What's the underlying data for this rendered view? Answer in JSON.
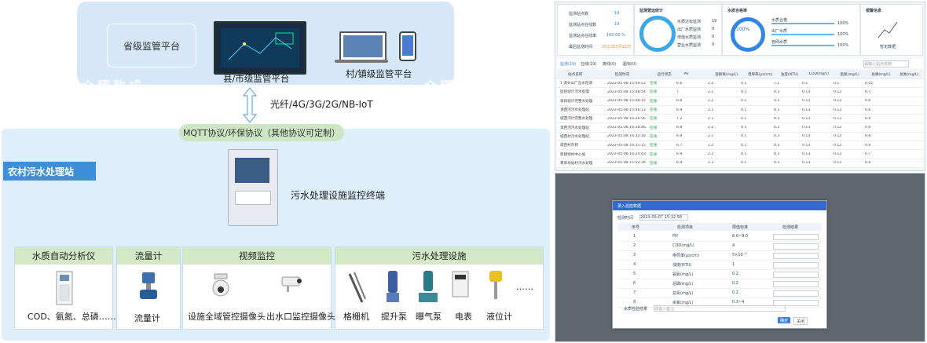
{
  "diagram": {
    "provincial_platform": "省级监管平台",
    "county_platform": "县/市级监管平台",
    "village_platform": "村/镇级监管平台",
    "network": "光纤/4G/3G/2G/NB-IoT",
    "protocol": "MQTT协议/环保协议（其他协议可定制）",
    "station": "农村污水处理站",
    "terminal": "污水处理设施监控终端",
    "watermark": "众耀数成",
    "groups": [
      {
        "title": "水质自动分析仪",
        "items": [
          "COD、氨氮、总磷……"
        ]
      },
      {
        "title": "流量计",
        "items": [
          "流量计"
        ]
      },
      {
        "title": "视频监控",
        "items": [
          "设施全域管控摄像头",
          "出水口监控摄像头"
        ]
      },
      {
        "title": "污水处理设施",
        "items": [
          "格栅机",
          "提升泵",
          "曝气泵",
          "电表",
          "液位计"
        ],
        "more": "……"
      }
    ]
  },
  "dashboard": {
    "stats": [
      {
        "label": "监测站点数",
        "value": "19"
      },
      {
        "label": "监测站点在线数",
        "value": "19"
      },
      {
        "label": "监测站点在线率",
        "value": "100.00 %"
      },
      {
        "label": "最后监测时间",
        "value": "2023年5月22日"
      }
    ],
    "sections": [
      "监测营运统计",
      "水质合格率",
      "报警信息"
    ],
    "gauge_value": "100",
    "gauge_unit": "%",
    "gauge_label": "水质合格率",
    "alarm_label": "暂无数据",
    "legend": [
      {
        "label": "水质达标监测",
        "value": "19"
      },
      {
        "label": "出厂水质监测",
        "value": "0"
      },
      {
        "label": "增值水质监测",
        "value": "0"
      },
      {
        "label": "营业水质监测",
        "value": "0"
      }
    ],
    "quality_bars": [
      {
        "label": "水质合格",
        "value": "100%"
      },
      {
        "label": "出厂水质",
        "value": "100%"
      },
      {
        "label": "管网水质",
        "value": "100%"
      }
    ],
    "tabs": [
      "监测(19)",
      "在线(19)",
      "离线(0)",
      "超标(0)"
    ],
    "search_placeholder": "请输入站点名称",
    "table_headers": [
      "站点名称",
      "检测时间",
      "运行状态",
      "PH",
      "溶解氧(mg/L)",
      "电导率(μs/cm)",
      "浊度(NTU)",
      "COD(mg/L)",
      "氨氮(mg/L)",
      "总磷(mg/L)",
      "总氮(mg/L)"
    ],
    "table_rows": [
      [
        "1 源头山厂出水检测",
        "2023-05-08 15:49:53",
        "在线",
        "6.6",
        "2.2",
        "0.1",
        "7.1",
        "0.1",
        "0.1",
        "0.05"
      ],
      [
        "监控站计污水处理",
        "2023-05-08 15:48:54",
        "在线",
        "7",
        "2.1",
        "0.1",
        "0.3",
        "0.13",
        "0.12",
        "0.7"
      ],
      [
        "第四组计完整水处理",
        "2023-05-08 15:48:15",
        "在线",
        "6.8",
        "2.2",
        "0.1",
        "0.3",
        "0.13",
        "0.12",
        "0.6"
      ],
      [
        "涌西河污水处理站",
        "2023-05-08 15:46:13",
        "在线",
        "6.9",
        "2.1",
        "0.1",
        "0.3",
        "0.13",
        "0.12",
        "0.6"
      ],
      [
        "城西河计完整水处理",
        "2023-05-08 16:26:56",
        "在线",
        "7.2",
        "2.1",
        "0.1",
        "0.3",
        "0.13",
        "0.12",
        "0.6"
      ],
      [
        "涌西河污水处理站",
        "2023-05-08 16:28:46",
        "在线",
        "6.8",
        "2.2",
        "0.1",
        "0.3",
        "0.13",
        "0.12",
        "0.6"
      ],
      [
        "城西村污水处理站",
        "2023-05-08 16:32:18",
        "在线",
        "6.8",
        "2.1",
        "0.1",
        "0.3",
        "0.13",
        "0.12",
        "0.6"
      ],
      [
        "城西村东侧",
        "2023-05-08 16:31:15",
        "在线",
        "6.7",
        "2.2",
        "0.1",
        "0.3",
        "0.13",
        "0.12",
        "0.6"
      ],
      [
        "新建组村中心站",
        "2023-05-08 16:24:43",
        "在线",
        "6.9",
        "2.2",
        "0.1",
        "0.3",
        "0.13",
        "0.12",
        "0.7"
      ],
      [
        "黄草坊站村污水处理",
        "2023-05-08 15:53:36",
        "在线",
        "6.9",
        "2.2",
        "0.1",
        "0.3",
        "0.13",
        "0.12",
        "0.6"
      ]
    ],
    "modal": {
      "title": "录入巡检数据",
      "time_label": "检测时间",
      "time_value": "2023-05-07 15:32:58",
      "headers": [
        "序号",
        "检测项目",
        "限值标准",
        "检测结果"
      ],
      "rows": [
        [
          "1",
          "PH",
          "6.0~9.0"
        ],
        [
          "2",
          "COD(mg/L)",
          "4"
        ],
        [
          "3",
          "电导率(μs/cm)",
          "5×10⁻³"
        ],
        [
          "4",
          "浊度(NTU)",
          "1"
        ],
        [
          "5",
          "氨氮(mg/L)",
          "0.2"
        ],
        [
          "6",
          "总磷(mg/L)",
          "0.2"
        ],
        [
          "7",
          "总氮(mg/L)",
          "0.2"
        ],
        [
          "8",
          "余氯(mg/L)",
          "0.3~4"
        ]
      ],
      "remark_label": "水质检验结果",
      "remark_placeholder": "请输入备注",
      "ok": "确定",
      "cancel": "关闭"
    }
  }
}
